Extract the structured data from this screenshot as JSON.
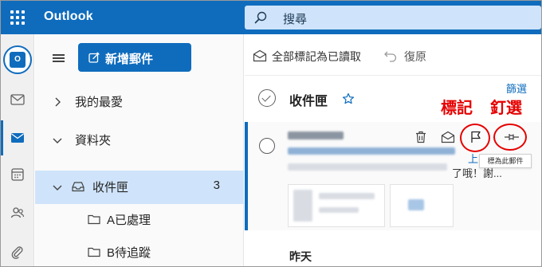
{
  "app": {
    "title": "Outlook"
  },
  "search": {
    "placeholder": "搜尋"
  },
  "folder_pane": {
    "new_mail_label": "新增郵件",
    "sections": [
      {
        "label": "我的最愛",
        "expanded": false
      },
      {
        "label": "資料夾",
        "expanded": true
      }
    ],
    "inbox": {
      "label": "收件匣",
      "count": "3"
    },
    "subfolders": [
      {
        "label": "A已處理"
      },
      {
        "label": "B待追蹤"
      }
    ]
  },
  "toolbar": {
    "mark_all_read_label": "全部標記為已讀取",
    "undo_label": "復原"
  },
  "message_list": {
    "title": "收件匣",
    "filter_label": "篩選",
    "selected_message": {
      "preview_tail": "了哦！謝...",
      "link_tail": "上"
    },
    "tooltip": "標為此郵件",
    "section_yesterday": "昨天"
  },
  "annotations": {
    "flag_label": "標記",
    "pin_label": "釘選"
  },
  "icons": {
    "rail": [
      "outlook-logo-icon",
      "compose-icon",
      "mail-icon",
      "calendar-icon",
      "people-icon",
      "attachment-icon"
    ],
    "message_actions": [
      "delete-icon",
      "mark-read-icon",
      "flag-icon",
      "pin-icon"
    ]
  },
  "colors": {
    "brand": "#0f6cbd",
    "search_bg": "#cfe4fa",
    "selected_folder_bg": "#cfe4fa",
    "annotation_red": "#e60000"
  }
}
